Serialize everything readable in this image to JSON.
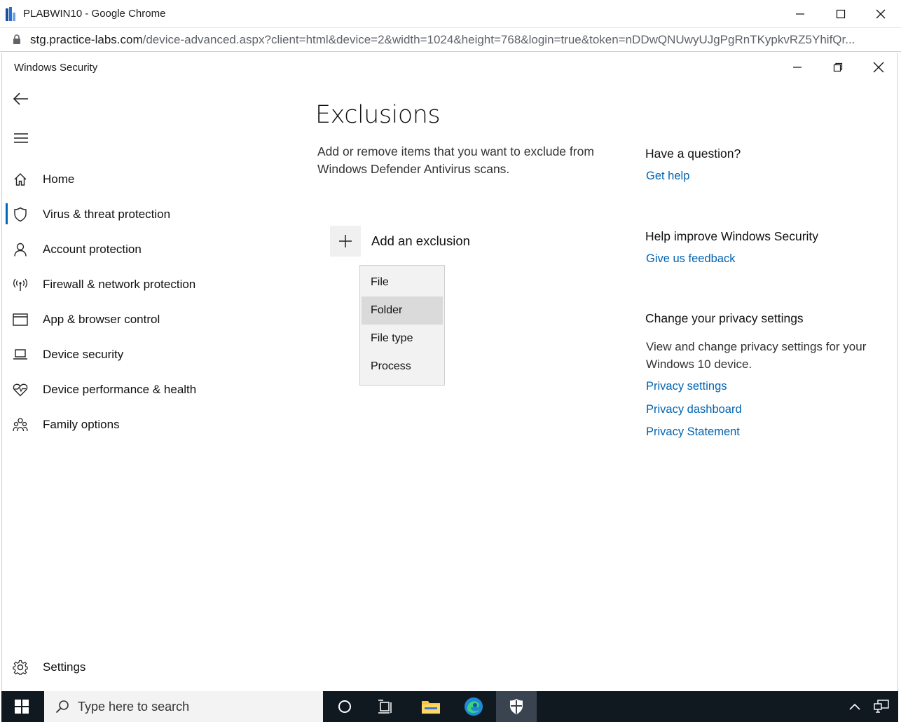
{
  "browser": {
    "window_title": "PLABWIN10 - Google Chrome",
    "url_host": "stg.practice-labs.com",
    "url_rest": "/device-advanced.aspx?client=html&device=2&width=1024&height=768&login=true&token=nDDwQNUwyUJgPgRnTKypkvRZ5YhifQr..."
  },
  "app": {
    "title": "Windows Security"
  },
  "nav": {
    "items": [
      {
        "label": "Home",
        "icon": "home-icon"
      },
      {
        "label": "Virus & threat protection",
        "icon": "shield-icon",
        "selected": true
      },
      {
        "label": "Account protection",
        "icon": "person-icon"
      },
      {
        "label": "Firewall & network protection",
        "icon": "antenna-icon"
      },
      {
        "label": "App & browser control",
        "icon": "app-window-icon"
      },
      {
        "label": "Device security",
        "icon": "laptop-icon"
      },
      {
        "label": "Device performance & health",
        "icon": "heart-pulse-icon"
      },
      {
        "label": "Family options",
        "icon": "family-icon"
      }
    ],
    "settings_label": "Settings"
  },
  "main": {
    "title": "Exclusions",
    "description": "Add or remove items that you want to exclude from Windows Defender Antivirus scans.",
    "add_label": "Add an exclusion",
    "menu": [
      "File",
      "Folder",
      "File type",
      "Process"
    ],
    "menu_hover_index": 1
  },
  "side": {
    "question_heading": "Have a question?",
    "get_help": "Get help",
    "improve_heading": "Help improve Windows Security",
    "feedback": "Give us feedback",
    "privacy_heading": "Change your privacy settings",
    "privacy_text": "View and change privacy settings for your Windows 10 device.",
    "privacy_settings": "Privacy settings",
    "privacy_dashboard": "Privacy dashboard",
    "privacy_statement": "Privacy Statement"
  },
  "taskbar": {
    "search_placeholder": "Type here to search"
  },
  "colors": {
    "accent": "#0067b8",
    "link": "#0063b1",
    "taskbar": "#101820"
  }
}
